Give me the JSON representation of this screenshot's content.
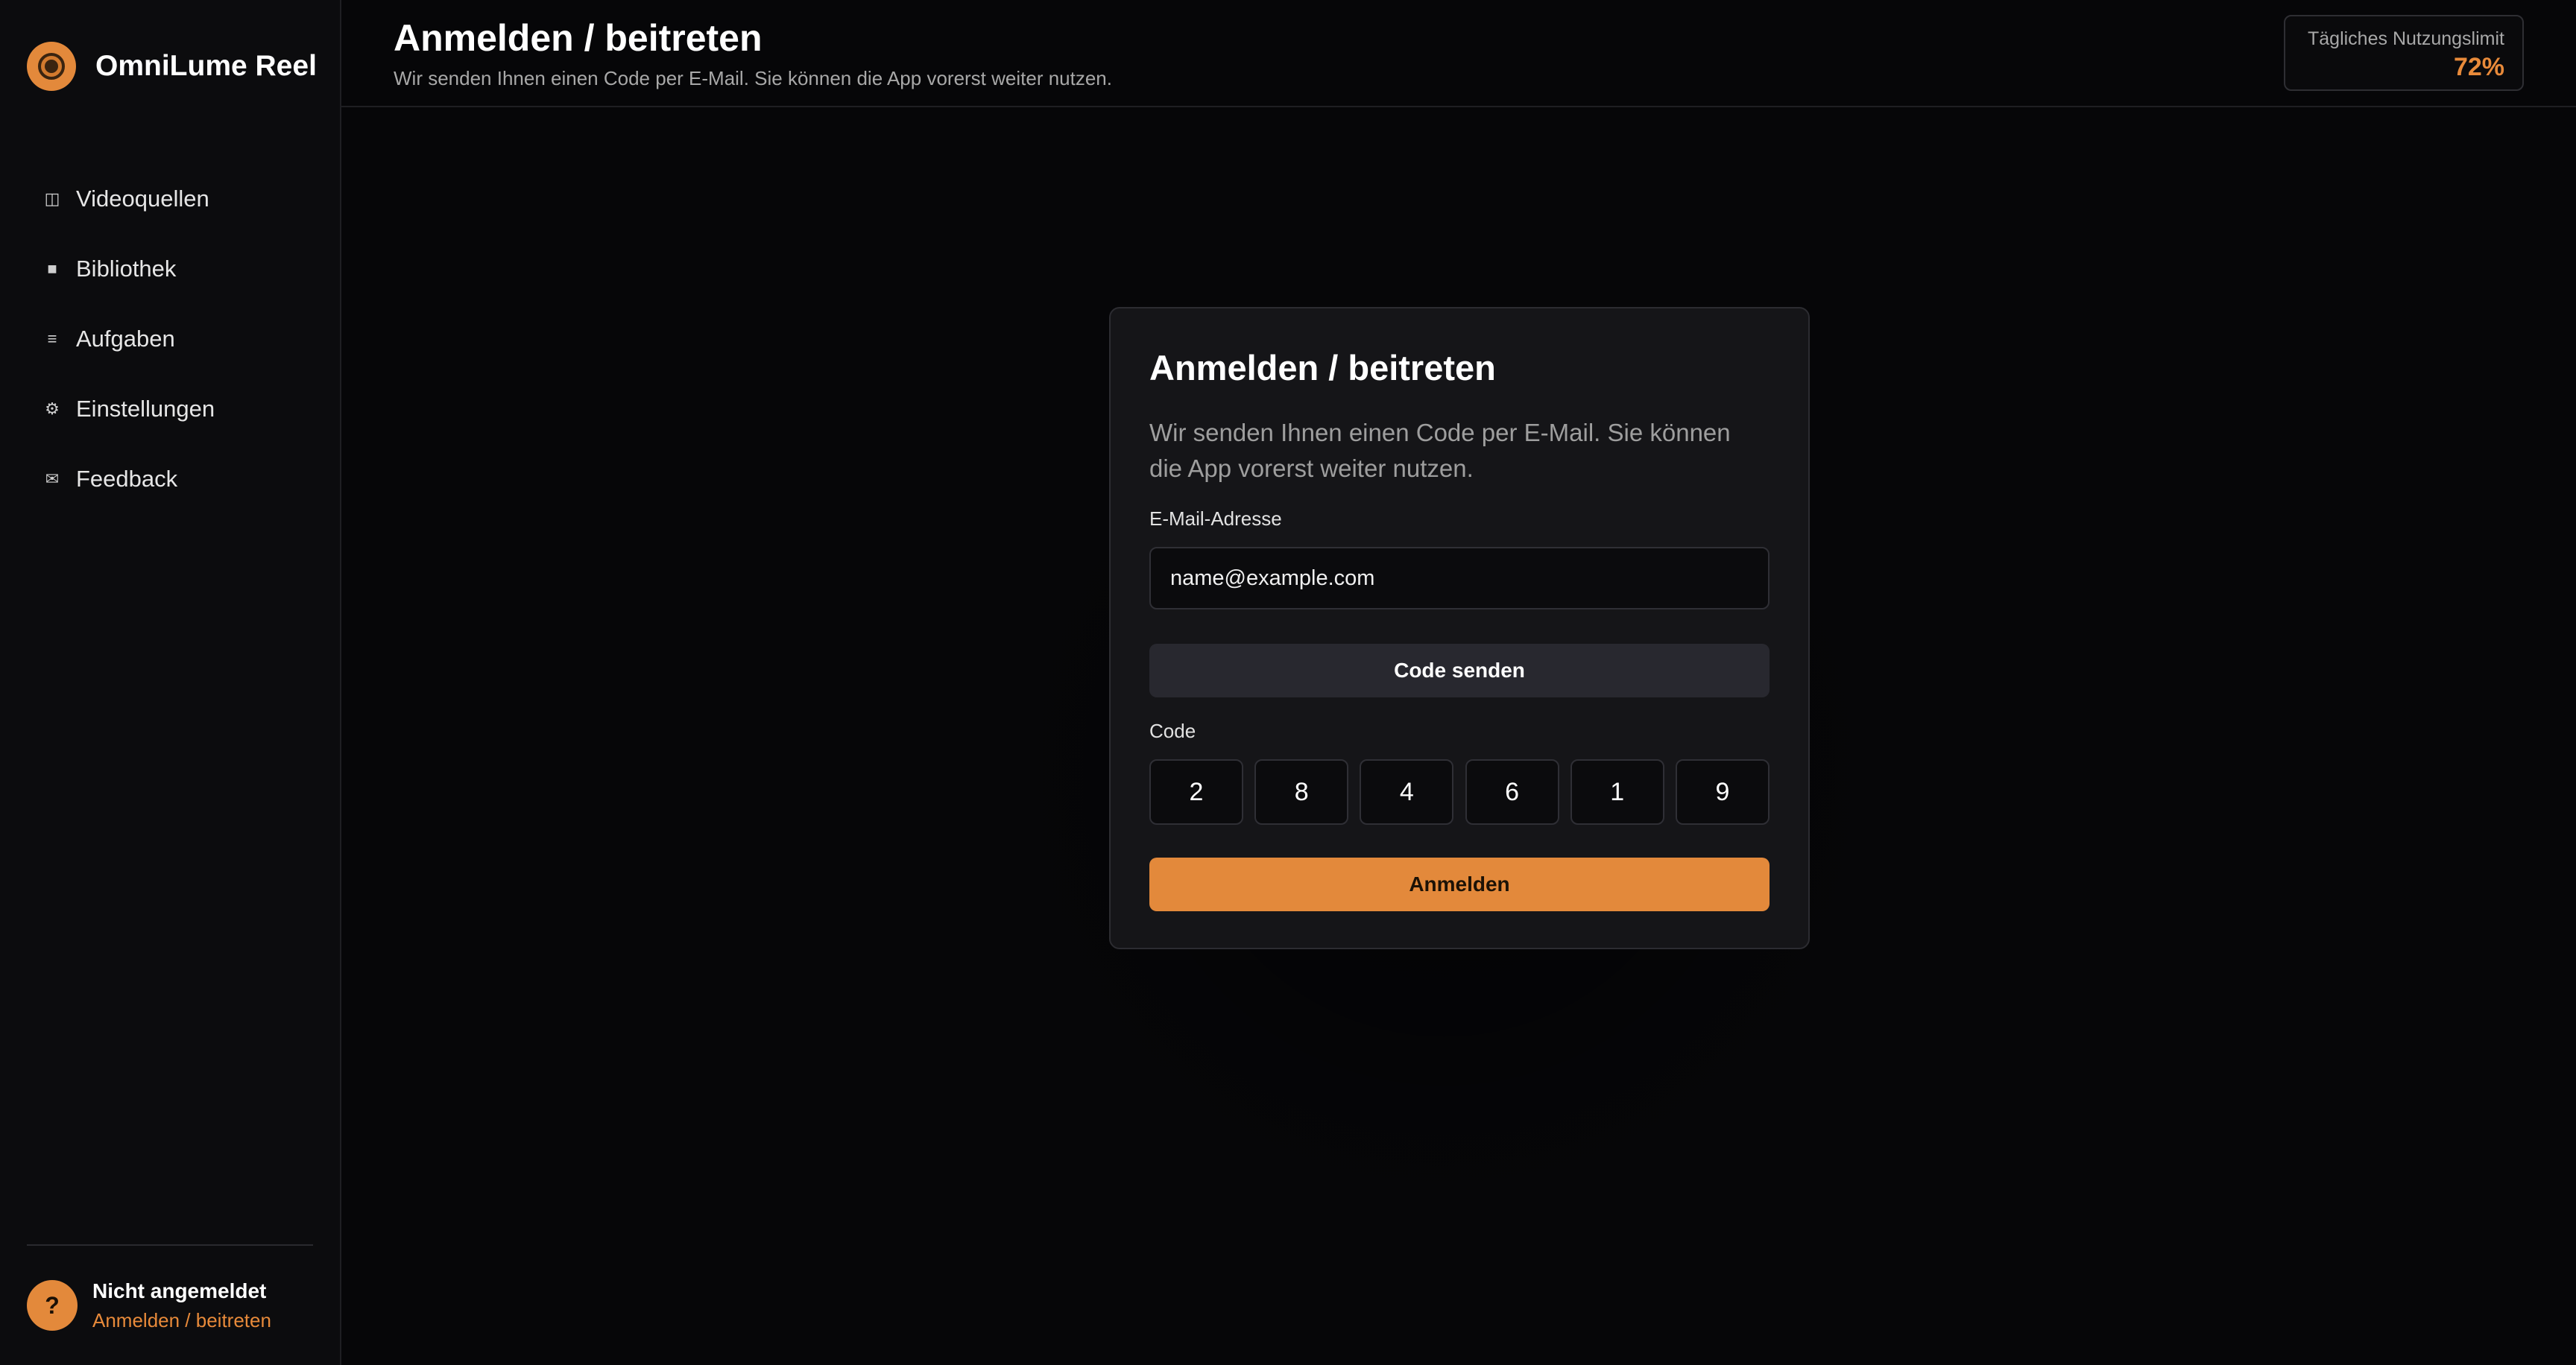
{
  "app": {
    "name": "OmniLume Reel",
    "logo_icon": "aperture-icon",
    "accent_color": "#e3893b"
  },
  "sidebar": {
    "items": [
      {
        "label": "Videoquellen",
        "icon": "columns-icon",
        "glyph": "◫"
      },
      {
        "label": "Bibliothek",
        "icon": "square-icon",
        "glyph": "■"
      },
      {
        "label": "Aufgaben",
        "icon": "list-icon",
        "glyph": "≡"
      },
      {
        "label": "Einstellungen",
        "icon": "gear-icon",
        "glyph": "⚙"
      },
      {
        "label": "Feedback",
        "icon": "mail-icon",
        "glyph": "✉"
      }
    ],
    "footer": {
      "avatar_glyph": "?",
      "status": "Nicht angemeldet",
      "link": "Anmelden / beitreten"
    }
  },
  "header": {
    "title": "Anmelden / beitreten",
    "subtitle": "Wir senden Ihnen einen Code per E-Mail. Sie können die App vorerst weiter nutzen.",
    "usage": {
      "label": "Tägliches Nutzungslimit",
      "value": "72%",
      "percent": 72
    }
  },
  "login_card": {
    "title": "Anmelden / beitreten",
    "description": "Wir senden Ihnen einen Code per E-Mail. Sie können die App vorerst weiter nutzen.",
    "email_label": "E-Mail-Adresse",
    "email_placeholder": "name@example.com",
    "email_value": "",
    "send_code_label": "Code senden",
    "code_label": "Code",
    "code_digits": [
      "2",
      "8",
      "4",
      "6",
      "1",
      "9"
    ],
    "submit_label": "Anmelden"
  }
}
